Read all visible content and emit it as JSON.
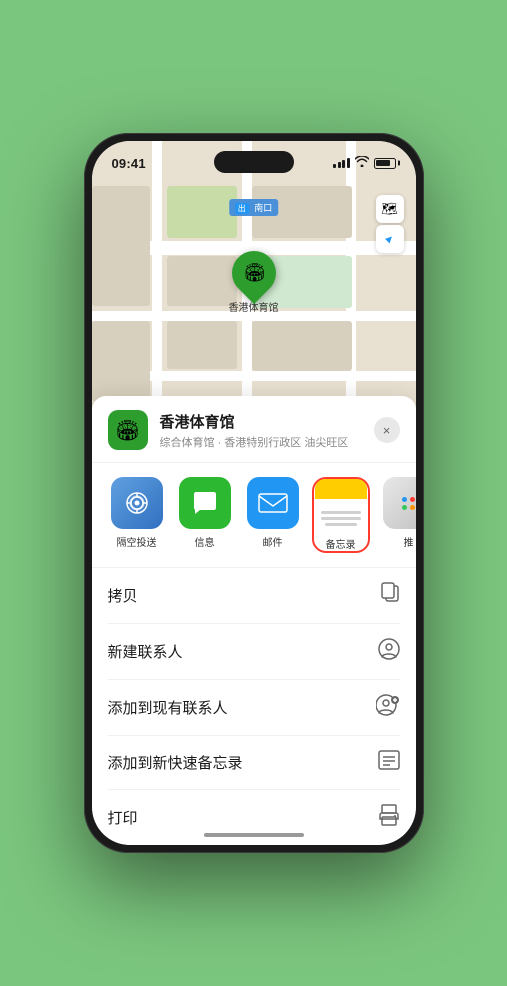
{
  "statusBar": {
    "time": "09:41",
    "locationArrow": "▲"
  },
  "map": {
    "label": "南口",
    "locationName": "香港体育馆",
    "pinEmoji": "🏟"
  },
  "mapControls": {
    "mapIcon": "🗺",
    "locationIcon": "➤"
  },
  "placeCard": {
    "name": "香港体育馆",
    "description": "综合体育馆 · 香港特别行政区 油尖旺区",
    "closeLabel": "×"
  },
  "shareApps": [
    {
      "id": "airdrop",
      "label": "隔空投送",
      "emoji": "📡"
    },
    {
      "id": "messages",
      "label": "信息",
      "emoji": "💬"
    },
    {
      "id": "mail",
      "label": "邮件",
      "emoji": "✉️"
    },
    {
      "id": "notes",
      "label": "备忘录",
      "highlighted": true
    },
    {
      "id": "more",
      "label": "推",
      "isMore": true
    }
  ],
  "actions": [
    {
      "id": "copy",
      "label": "拷贝",
      "icon": "📋"
    },
    {
      "id": "new-contact",
      "label": "新建联系人",
      "icon": "👤"
    },
    {
      "id": "add-contact",
      "label": "添加到现有联系人",
      "icon": "👤+"
    },
    {
      "id": "quick-note",
      "label": "添加到新快速备忘录",
      "icon": "📝"
    },
    {
      "id": "print",
      "label": "打印",
      "icon": "🖨"
    }
  ]
}
